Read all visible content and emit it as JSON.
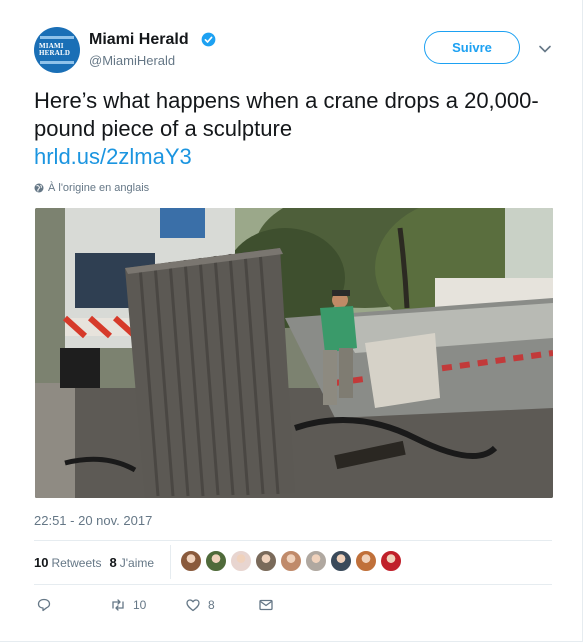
{
  "account": {
    "name": "Miami Herald",
    "handle": "@MiamiHerald",
    "avatar_logo_line1": "MIAMI",
    "avatar_logo_line2": "HERALD",
    "verified": true
  },
  "header": {
    "follow_label": "Suivre"
  },
  "tweet": {
    "text": "Here’s what happens when a crane drops a 20,000-pound piece of a sculpture",
    "link": "hrld.us/2zlmaY3",
    "translate_label": "À l'origine en anglais",
    "timestamp": "22:51 - 20 nov. 2017"
  },
  "stats": {
    "retweets_count": "10",
    "retweets_label": "Retweets",
    "likes_count": "8",
    "likes_label": "J'aime",
    "liker_colors": [
      "#8a5a3c",
      "#4f6a3a",
      "#e8d5d0",
      "#7a6a5a",
      "#c08a6a",
      "#b0a8a0",
      "#3a4a5a",
      "#c0703a",
      "#c0202a"
    ]
  },
  "actions": {
    "reply_icon": "reply-icon",
    "retweet_count": "10",
    "like_count": "8",
    "message_icon": "envelope-icon"
  },
  "colors": {
    "link": "#1b95e0",
    "accent": "#1da1f2",
    "muted": "#657786",
    "brand": "#1a6fb6"
  }
}
